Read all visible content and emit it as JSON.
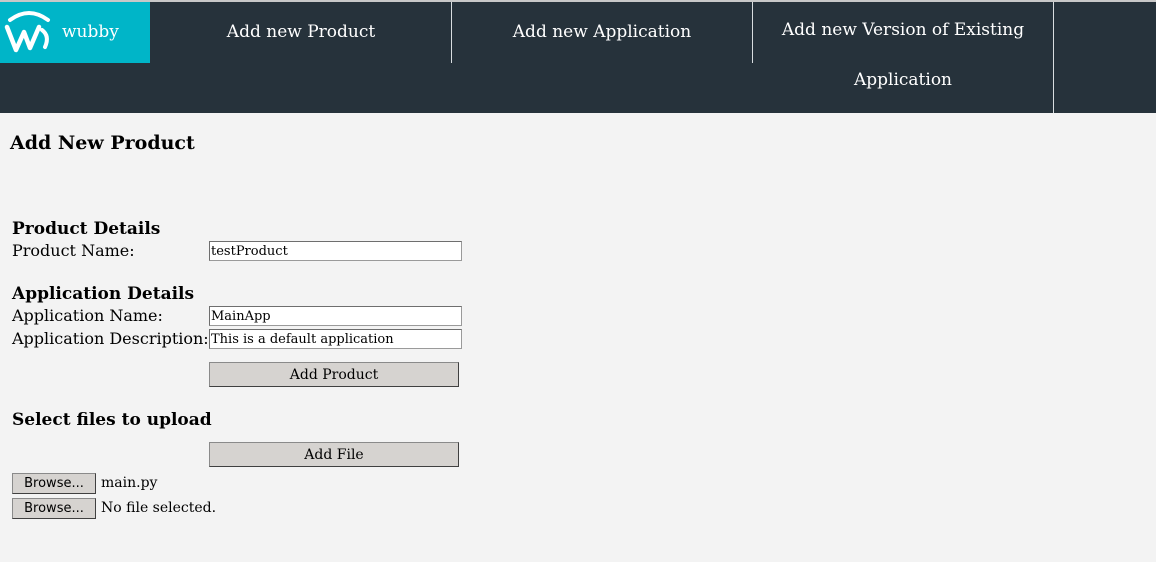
{
  "nav": {
    "brand": "wubby",
    "brand_color": "#00b5c8",
    "background_color": "#26323b",
    "items": [
      {
        "label": "Add new Product"
      },
      {
        "label": "Add new Application"
      },
      {
        "label_line1": "Add new Version of Existing",
        "label_line2": "Application"
      }
    ]
  },
  "page": {
    "title": "Add New Product"
  },
  "product_details": {
    "heading": "Product Details",
    "name_label": "Product Name:",
    "name_value": "testProduct"
  },
  "application_details": {
    "heading": "Application Details",
    "name_label": "Application Name:",
    "name_value": "MainApp",
    "description_label": "Application Description:",
    "description_value": "This is a default application"
  },
  "add_product_button": "Add Product",
  "upload": {
    "heading": "Select files to upload",
    "add_file_button": "Add File",
    "files": [
      {
        "browse_label": "Browse...",
        "status": "main.py"
      },
      {
        "browse_label": "Browse...",
        "status": "No file selected."
      }
    ]
  },
  "icons": {
    "brand_logo": "wubby-logo-icon"
  }
}
